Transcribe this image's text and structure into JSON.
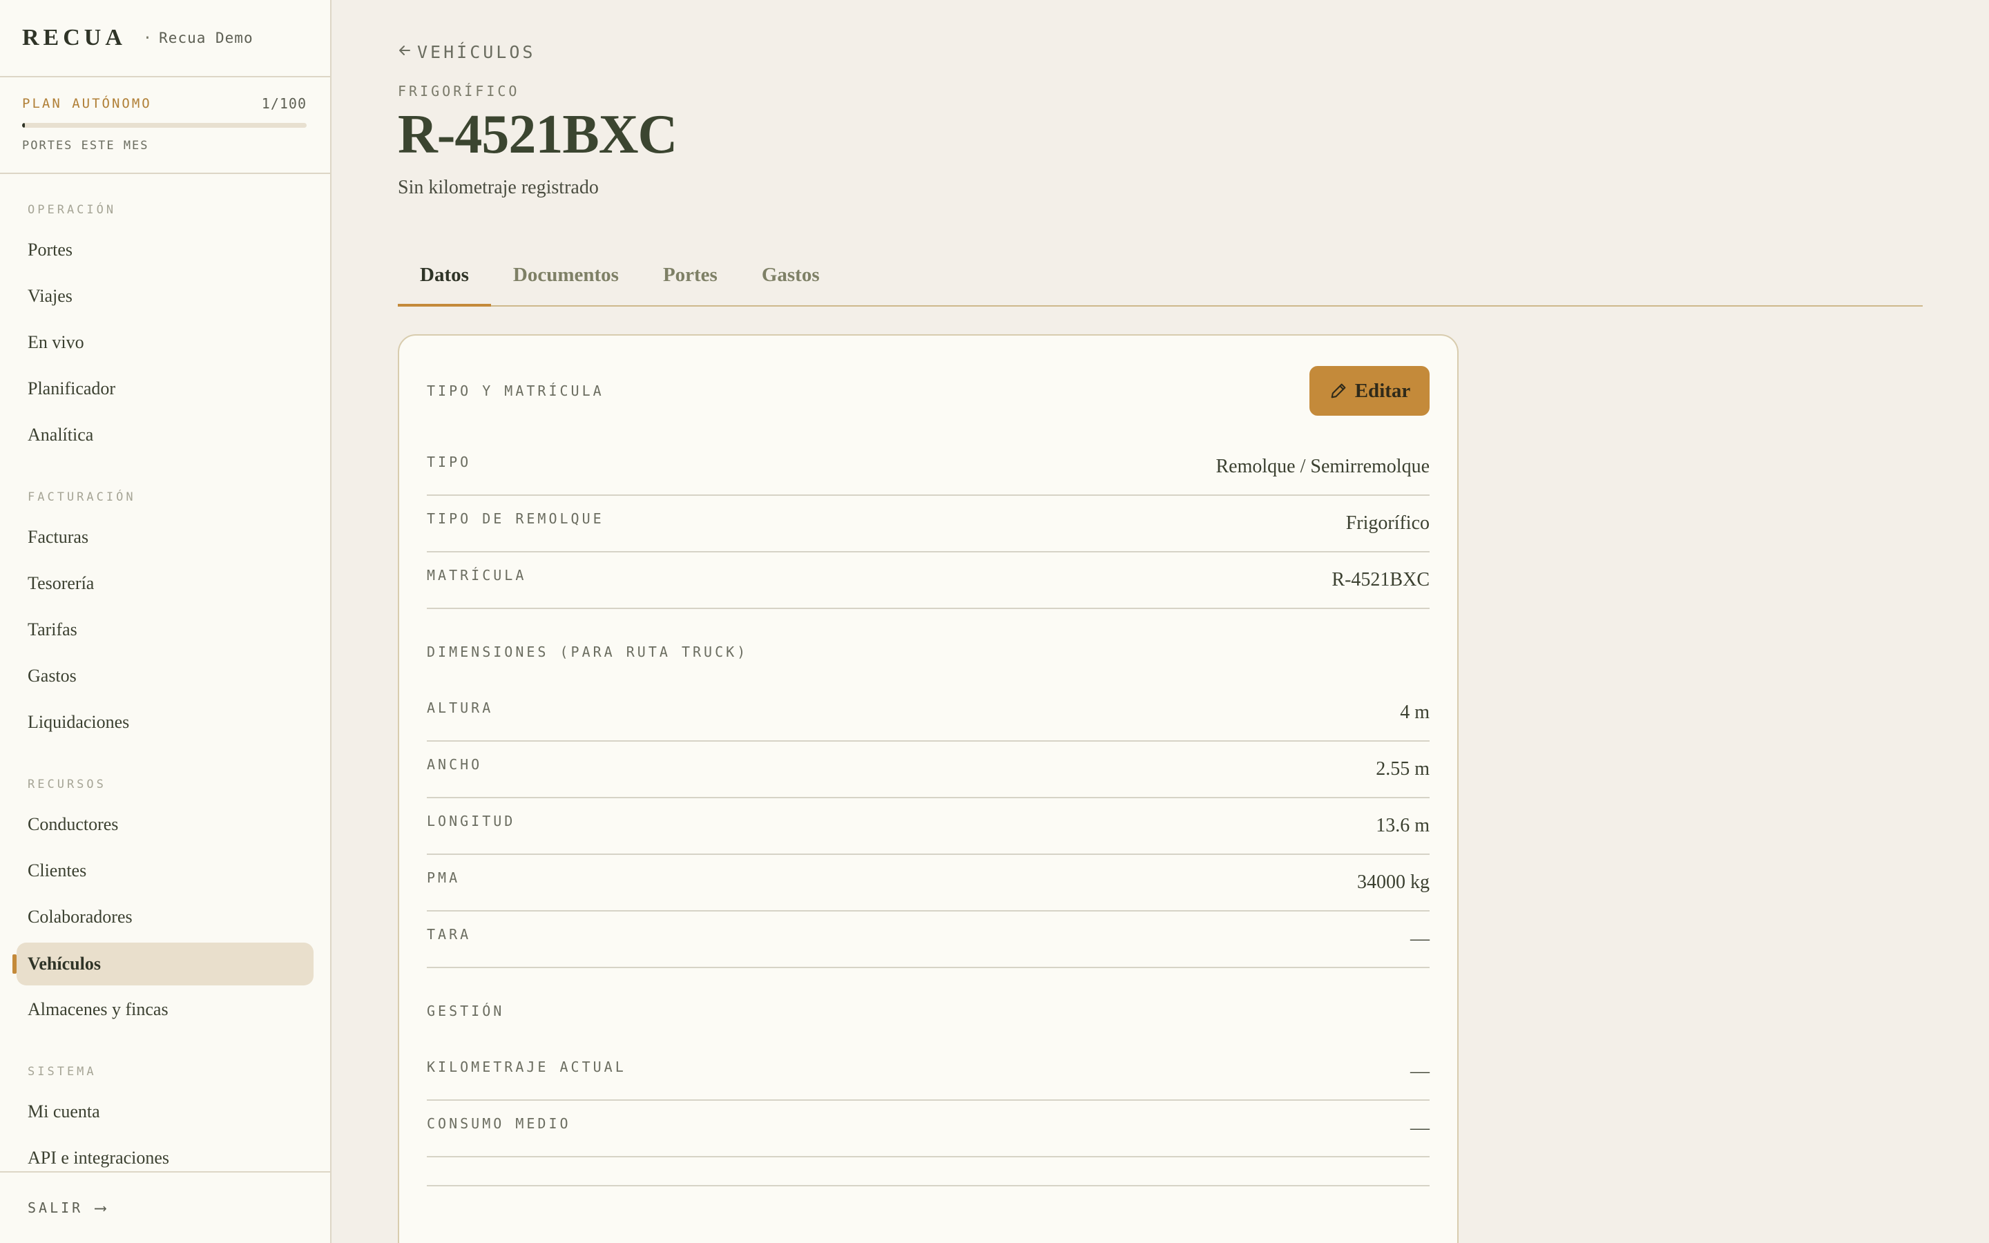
{
  "brand": {
    "logo": "RECUA",
    "separator": "·",
    "org": "Recua Demo"
  },
  "plan": {
    "name": "PLAN AUTÓNOMO",
    "count": "1/100",
    "progress": 0.01,
    "label": "PORTES ESTE MES"
  },
  "nav": {
    "operacion": {
      "label": "OPERACIÓN",
      "items": [
        "Portes",
        "Viajes",
        "En vivo",
        "Planificador",
        "Analítica"
      ]
    },
    "facturacion": {
      "label": "FACTURACIÓN",
      "items": [
        "Facturas",
        "Tesorería",
        "Tarifas",
        "Gastos",
        "Liquidaciones"
      ]
    },
    "recursos": {
      "label": "RECURSOS",
      "items": [
        "Conductores",
        "Clientes",
        "Colaboradores",
        "Vehículos",
        "Almacenes y fincas"
      ],
      "active": "Vehículos"
    },
    "sistema": {
      "label": "SISTEMA",
      "items": [
        "Mi cuenta",
        "API e integraciones"
      ]
    }
  },
  "logout": {
    "label": "SALIR",
    "arrow": "⟶"
  },
  "header": {
    "back_label": "VEHÍCULOS",
    "eyebrow": "FRIGORÍFICO",
    "title": "R-4521BXC",
    "subtitle": "Sin kilometraje registrado"
  },
  "tabs": [
    "Datos",
    "Documentos",
    "Portes",
    "Gastos"
  ],
  "active_tab": "Datos",
  "card": {
    "edit_label": "Editar",
    "tipo_section": {
      "title": "TIPO Y MATRÍCULA",
      "rows": [
        {
          "label": "TIPO",
          "value": "Remolque / Semirremolque"
        },
        {
          "label": "TIPO DE REMOLQUE",
          "value": "Frigorífico"
        },
        {
          "label": "MATRÍCULA",
          "value": "R-4521BXC"
        }
      ]
    },
    "dimensiones_section": {
      "title": "DIMENSIONES (PARA RUTA TRUCK)",
      "rows": [
        {
          "label": "ALTURA",
          "value": "4 m"
        },
        {
          "label": "ANCHO",
          "value": "2.55 m"
        },
        {
          "label": "LONGITUD",
          "value": "13.6 m"
        },
        {
          "label": "PMA",
          "value": "34000 kg"
        },
        {
          "label": "TARA",
          "value": "—"
        }
      ]
    },
    "gestion_section": {
      "title": "GESTIÓN",
      "rows": [
        {
          "label": "KILOMETRAJE ACTUAL",
          "value": "—"
        },
        {
          "label": "CONSUMO MEDIO",
          "value": "—"
        }
      ]
    }
  },
  "colors": {
    "accent": "#c48a3a",
    "background": "#f3efe8",
    "sidebar": "#fbfaf4",
    "text": "#2f3427"
  },
  "icons": {
    "back": "arrow-left-icon",
    "edit": "pencil-icon",
    "logout": "arrow-right-icon"
  }
}
